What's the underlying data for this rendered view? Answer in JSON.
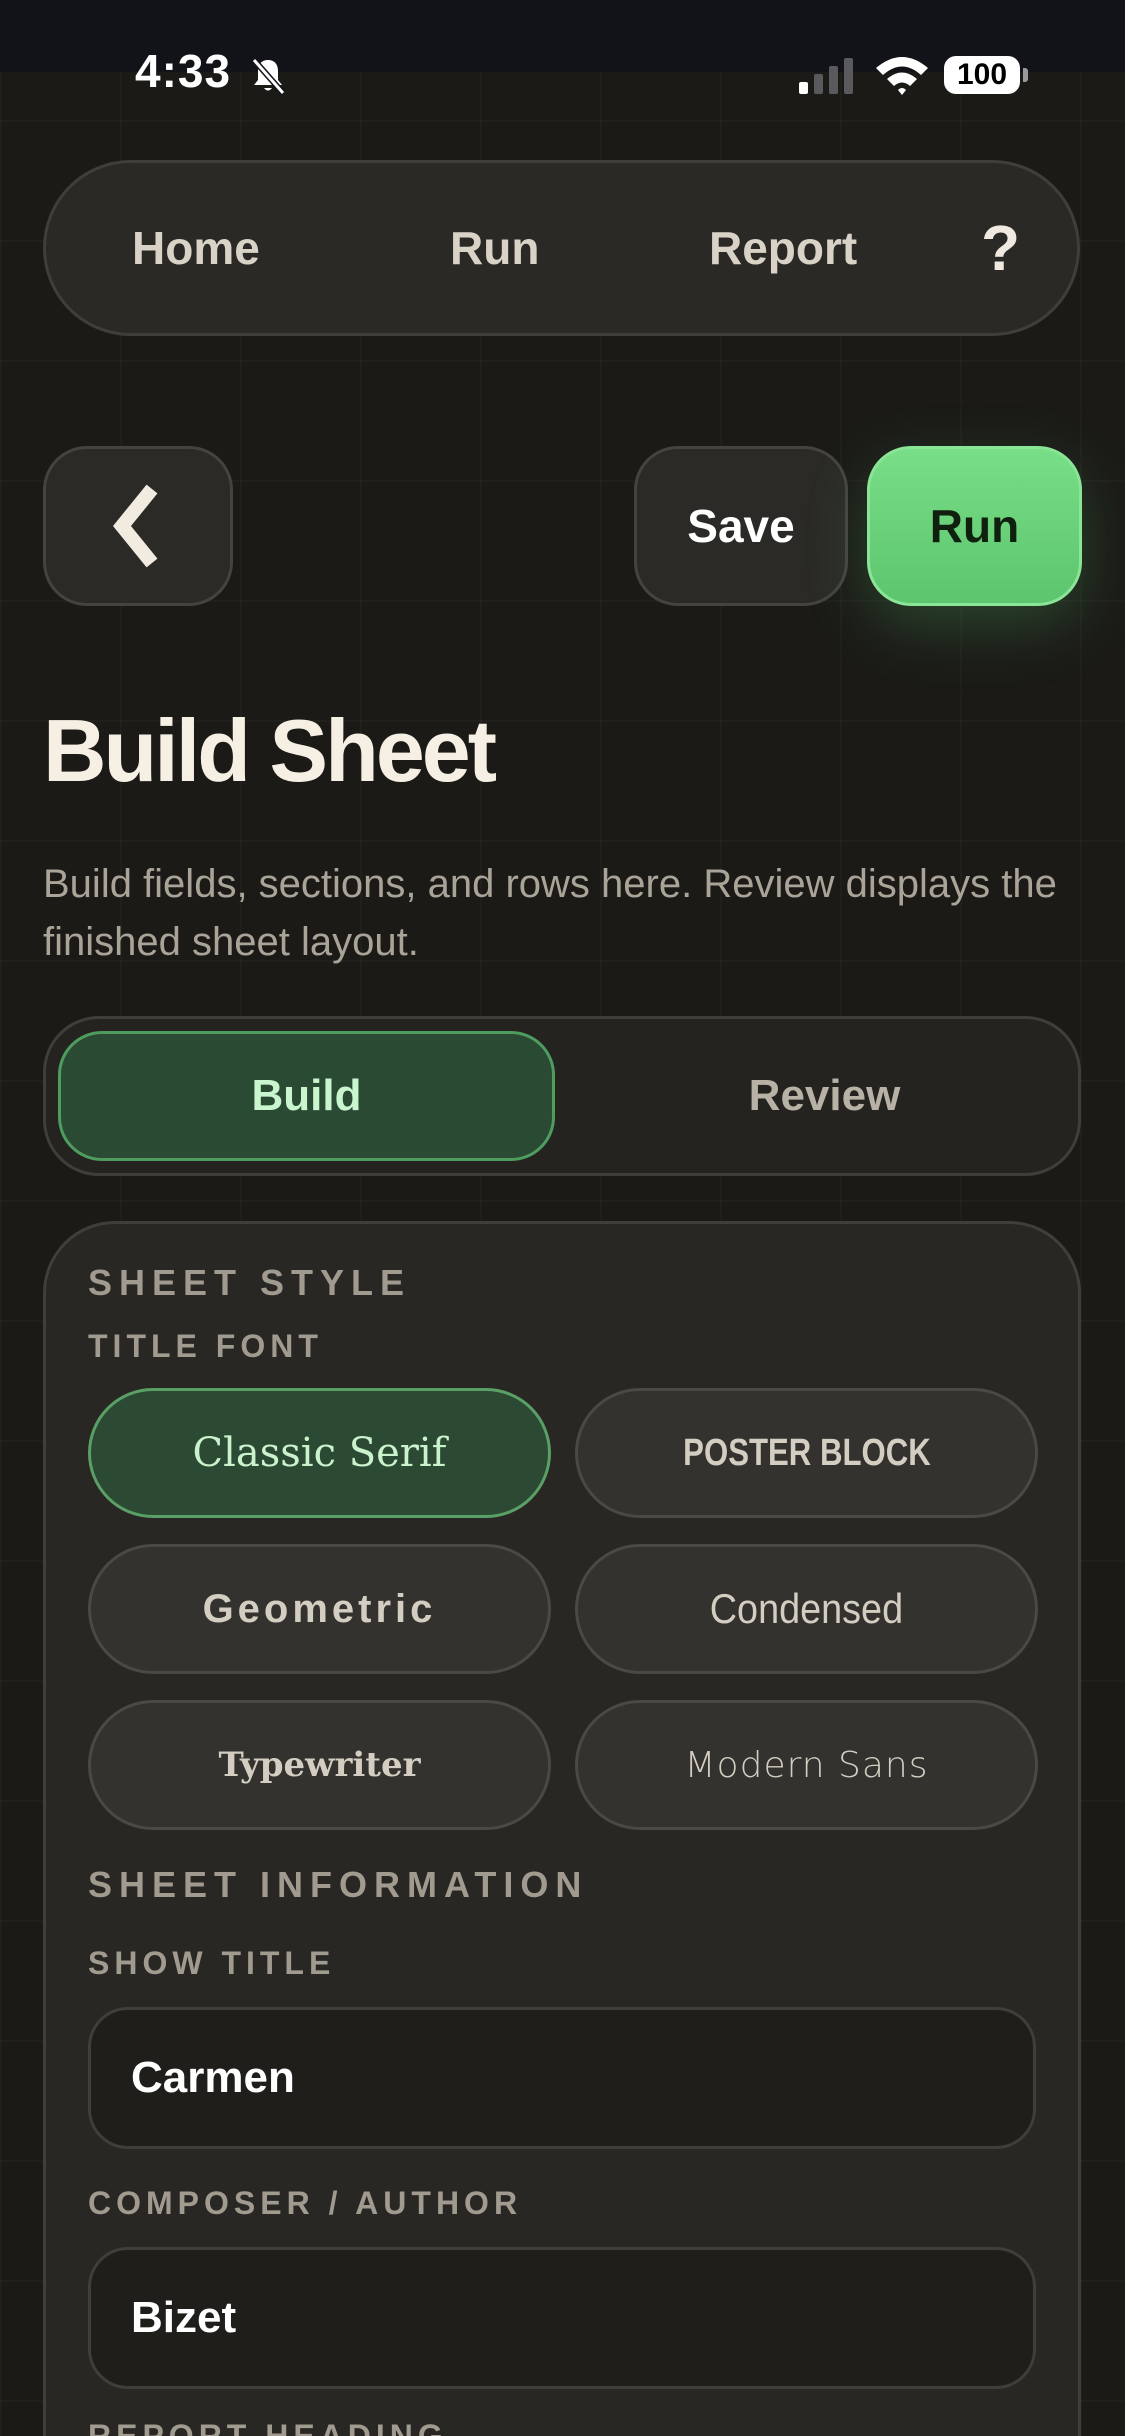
{
  "status_bar": {
    "time": "4:33",
    "battery": "100"
  },
  "nav": {
    "home": "Home",
    "run": "Run",
    "report": "Report",
    "help": "?"
  },
  "actions": {
    "back_icon": "chevron-left-icon",
    "save": "Save",
    "run": "Run"
  },
  "page": {
    "title": "Build Sheet",
    "subtitle": "Build fields, sections, and rows here. Review displays the finished sheet layout."
  },
  "segment": {
    "build": "Build",
    "review": "Review",
    "selected": "Build"
  },
  "sheet_style": {
    "section_label": "SHEET STYLE",
    "title_font_label": "TITLE FONT",
    "fonts": [
      "Classic Serif",
      "POSTER BLOCK",
      "Geometric",
      "Condensed",
      "Typewriter",
      "Modern Sans"
    ],
    "selected_font": "Classic Serif"
  },
  "sheet_information": {
    "section_label": "SHEET INFORMATION",
    "show_title_label": "SHOW TITLE",
    "show_title_value": "Carmen",
    "composer_label": "COMPOSER / AUTHOR",
    "composer_value": "Bizet",
    "report_heading_label": "REPORT HEADING"
  },
  "colors": {
    "accent_green": "#6dd67d",
    "background": "#1b1a17",
    "card": "#282724"
  }
}
